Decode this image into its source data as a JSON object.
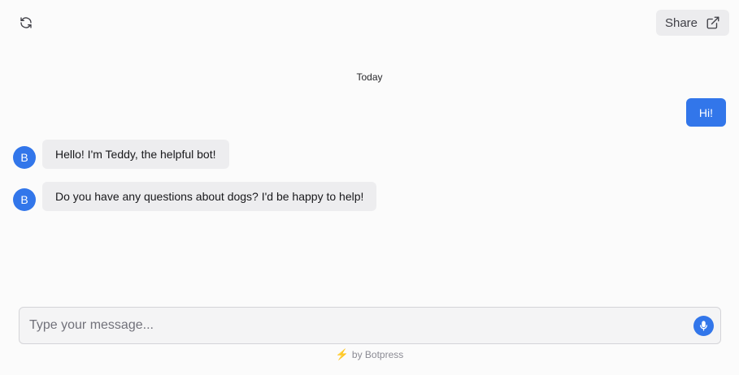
{
  "header": {
    "refresh_icon": "refresh-icon",
    "share_label": "Share",
    "share_icon": "external-link-icon"
  },
  "conversation": {
    "date_divider": "Today",
    "messages": [
      {
        "sender": "user",
        "text": "Hi!"
      },
      {
        "sender": "bot",
        "avatar": "B",
        "text": "Hello! I'm Teddy, the helpful bot!"
      },
      {
        "sender": "bot",
        "avatar": "B",
        "text": "Do you have any questions about dogs? I'd be happy to help!"
      }
    ]
  },
  "composer": {
    "placeholder": "Type your message...",
    "value": "",
    "mic_icon": "microphone-icon"
  },
  "footer": {
    "icon": "lightning-icon",
    "label": "by Botpress"
  },
  "colors": {
    "accent": "#3276ea",
    "background": "#fbfbfb",
    "bot_bubble": "#ededef"
  }
}
